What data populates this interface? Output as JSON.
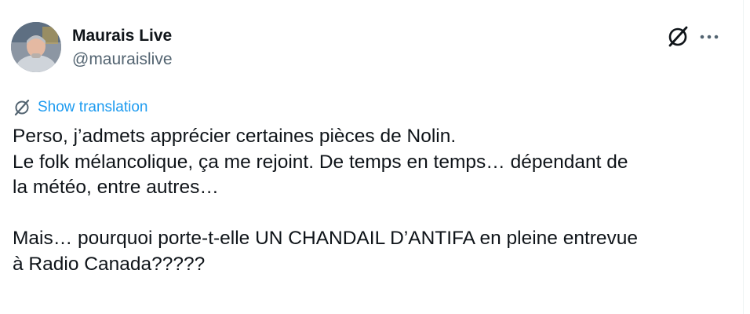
{
  "author": {
    "display_name": "Maurais Live",
    "handle": "@mauraislive",
    "avatar_icon": "avatar-photo"
  },
  "actions": {
    "grok_icon": "grok-icon",
    "more_icon": "more-horizontal-icon"
  },
  "translate": {
    "icon": "translate-icon",
    "label": "Show translation",
    "color": "#1d9bf0"
  },
  "tweet": {
    "lines": [
      "Perso, j’admets apprécier certaines pièces de Nolin.",
      "Le folk mélancolique, ça me rejoint. De temps en temps… dépendant de",
      "la météo, entre autres…",
      "",
      "Mais… pourquoi porte-t-elle UN CHANDAIL D’ANTIFA en pleine entrevue",
      "à Radio Canada?????"
    ]
  },
  "colors": {
    "text": "#0f1419",
    "secondary": "#536471",
    "link": "#1d9bf0"
  }
}
